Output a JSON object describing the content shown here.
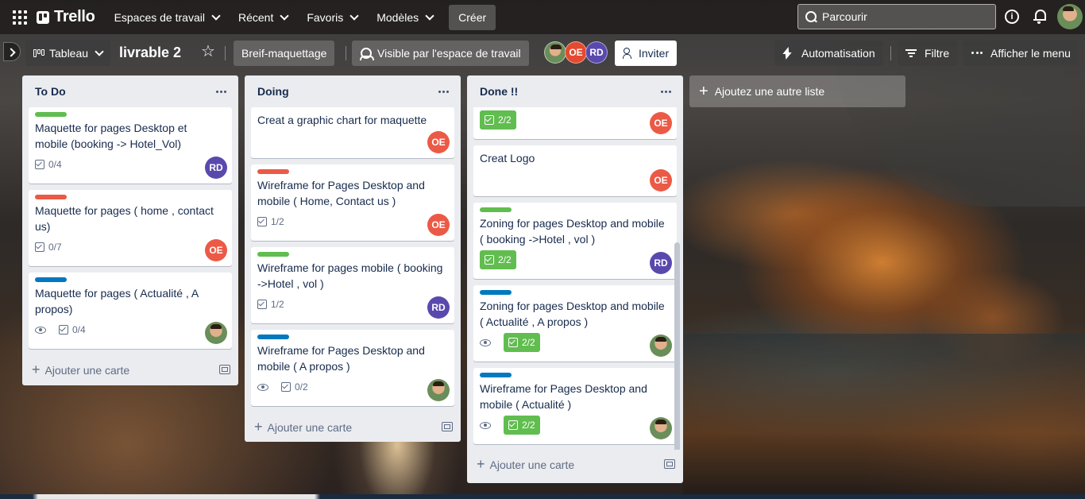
{
  "header": {
    "logo_text": "Trello",
    "nav": [
      "Espaces de travail",
      "Récent",
      "Favoris",
      "Modèles"
    ],
    "create_label": "Créer",
    "search_placeholder": "Parcourir"
  },
  "board": {
    "view_label": "Tableau",
    "title": "livrable 2",
    "tag_button": "Breif-maquettage",
    "visibility_label": "Visible par l'espace de travail",
    "members": [
      {
        "initials": "",
        "kind": "photo"
      },
      {
        "initials": "OE",
        "kind": "oe"
      },
      {
        "initials": "RD",
        "kind": "rd"
      }
    ],
    "invite_label": "Inviter",
    "automation_label": "Automatisation",
    "filter_label": "Filtre",
    "menu_label": "Afficher le menu"
  },
  "lists": [
    {
      "title": "To Do",
      "add_label": "Ajouter une carte",
      "cards": [
        {
          "label_color": "#61bd4f",
          "title": "Maquette for pages Desktop et mobile (booking -> Hotel_Vol)",
          "checklist": "0/4",
          "avatar": "RD"
        },
        {
          "label_color": "#eb5a46",
          "title": "Maquette for pages ( home , contact us)",
          "checklist": "0/7",
          "avatar": "OE"
        },
        {
          "label_color": "#0079bf",
          "title": "Maquette for pages ( Actualité , A propos)",
          "checklist": "0/4",
          "avatar": "photo",
          "watch": true
        }
      ]
    },
    {
      "title": "Doing",
      "add_label": "Ajouter une carte",
      "cards": [
        {
          "label_color": "",
          "title": "Creat a graphic chart for maquette",
          "checklist": "",
          "avatar": "OE"
        },
        {
          "label_color": "#eb5a46",
          "title": "Wireframe for Pages Desktop and mobile ( Home, Contact us )",
          "checklist": "1/2",
          "avatar": "OE"
        },
        {
          "label_color": "#61bd4f",
          "title": "Wireframe for pages mobile ( booking ->Hotel , vol )",
          "checklist": "1/2",
          "avatar": "RD"
        },
        {
          "label_color": "#0079bf",
          "title": "Wireframe for Pages Desktop and mobile ( A propos )",
          "checklist": "0/2",
          "avatar": "photo",
          "watch": true
        }
      ]
    },
    {
      "title": "Done !!",
      "add_label": "Ajouter une carte",
      "cards": [
        {
          "label_color": "",
          "title": "",
          "checklist": "2/2",
          "checklist_done": true,
          "avatar": "OE",
          "partial": true
        },
        {
          "label_color": "",
          "title": "Creat Logo",
          "checklist": "",
          "avatar": "OE"
        },
        {
          "label_color": "#61bd4f",
          "title": "Zoning for pages Desktop and mobile ( booking ->Hotel , vol )",
          "checklist": "2/2",
          "checklist_done": true,
          "avatar": "RD"
        },
        {
          "label_color": "#0079bf",
          "title": "Zoning for pages Desktop and mobile ( Actualité , A propos )",
          "checklist": "2/2",
          "checklist_done": true,
          "avatar": "photo",
          "watch": true
        },
        {
          "label_color": "#0079bf",
          "title": "Wireframe for Pages Desktop and mobile ( Actualité )",
          "checklist": "2/2",
          "checklist_done": true,
          "avatar": "photo",
          "watch": true
        }
      ]
    }
  ],
  "add_list_label": "Ajoutez une autre liste",
  "colors": {
    "green": "#61bd4f",
    "red": "#eb5a46",
    "blue": "#0079bf",
    "avatar_oe": "#e34a2f",
    "avatar_rd": "#5a49ad"
  }
}
